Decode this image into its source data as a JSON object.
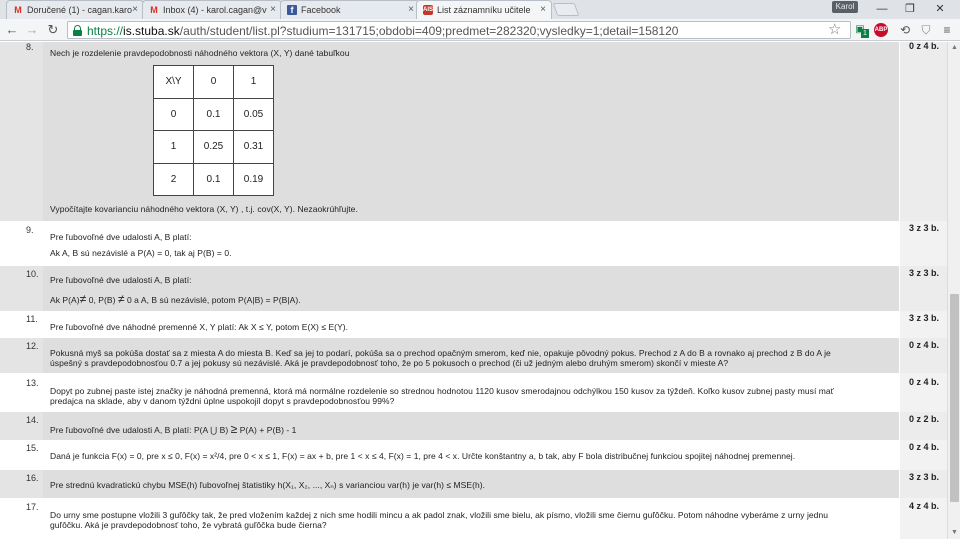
{
  "tabs": [
    {
      "label": "Doručené (1) - cagan.karo",
      "icon": "gmail-icon"
    },
    {
      "label": "Inbox (4) - karol.cagan@v",
      "icon": "gmail-icon"
    },
    {
      "label": "Facebook",
      "icon": "facebook-icon"
    },
    {
      "label": "List záznamníku učitele",
      "icon": "ais-icon"
    }
  ],
  "user_badge": "Karol",
  "window": {
    "minimize": "—",
    "restore": "❐",
    "close": "✕"
  },
  "toolbar": {
    "back": "←",
    "forward": "→",
    "reload": "↻",
    "url_scheme": "https://",
    "url_host": "is.stuba.sk",
    "url_path": "/auth/student/list.pl?studium=131715;obdobi=409;predmet=282320;vysledky=1;detail=158120",
    "zoom_glyph": "⌕",
    "star": "☆",
    "ext_badge_count": "1",
    "abp_label": "ABP"
  },
  "questions": [
    {
      "num": "8.",
      "points": "0 z 4 b.",
      "lines": [
        "Nech je rozdelenie pravdepodobnosti náhodného vektora  (X, Y)  dané tabuľkou",
        "Vypočítajte kovarianciu náhodného vektora  (X, Y) , t.j. cov(X, Y). Nezaokrúhľujte."
      ],
      "table": [
        [
          "X\\Y",
          "0",
          "1"
        ],
        [
          "0",
          "0.1",
          "0.05"
        ],
        [
          "1",
          "0.25",
          "0.31"
        ],
        [
          "2",
          "0.1",
          "0.19"
        ]
      ]
    },
    {
      "num": "9.",
      "points": "3 z 3 b.",
      "lines": [
        "Pre ľubovoľné dve udalosti  A, B  platí:",
        "Ak A, B  sú nezávislé a  P(A) = 0, tak aj  P(B) = 0."
      ]
    },
    {
      "num": "10.",
      "points": "3 z 3 b.",
      "lines": [
        "Pre ľubovoľné dve udalosti  A, B  platí:",
        "Ak  P(A)",
        " 0, P(B) ",
        " 0  a  A, B  sú nezávislé, potom  P(A|B) = P(B|A)."
      ],
      "neq": "≠"
    },
    {
      "num": "11.",
      "points": "3 z 3 b.",
      "lines": [
        "Pre ľubovoľné dve náhodné premenné  X, Y  platí: Ak  X ≤ Y, potom  E(X) ≤ E(Y)."
      ]
    },
    {
      "num": "12.",
      "points": "0 z 4 b.",
      "lines": [
        "Pokusná myš sa pokúša dostať sa z miesta A do miesta B. Keď sa jej to podarí, pokúša sa o prechod opačným smerom, keď nie, opakuje pôvodný pokus. Prechod z A do B a rovnako aj prechod z B do A je",
        "úspešný s pravdepodobnosťou 0.7 a jej pokusy sú nezávislé. Aká je pravdepodobnosť toho, že po 5 pokusoch o prechod (či už jedným alebo druhým smerom) skončí v mieste A?"
      ]
    },
    {
      "num": "13.",
      "points": "0 z 4 b.",
      "lines": [
        "Dopyt po zubnej paste istej značky je náhodná premenná, ktorá má normálne rozdelenie so strednou hodnotou 1120 kusov smerodajnou odchýlkou 150 kusov za týždeň. Koľko kusov zubnej pasty musí mať",
        "predajca na sklade, aby v danom týždni úplne uspokojil dopyt s pravdepodobnosťou 99%?"
      ]
    },
    {
      "num": "14.",
      "points": "0 z 2 b.",
      "lines": [
        "Pre ľubovoľné dve udalosti  A, B  platí:  P(A ⋃ B) ",
        " P(A) + P(B) - 1"
      ],
      "geq": "≥"
    },
    {
      "num": "15.",
      "points": "0 z 4 b.",
      "lines": [
        "Daná je funkcia  F(x) = 0, pre  x ≤ 0, F(x) = x²/4, pre  0 < x ≤ 1, F(x) = ax + b, pre  1 < x ≤ 4, F(x) = 1, pre  4 < x. Určte konštantny  a, b  tak, aby  F  bola distribučnej funkciou spojitej náhodnej premennej."
      ]
    },
    {
      "num": "16.",
      "points": "3 z 3 b.",
      "lines": [
        "Pre strednú kvadratickú chybu  MSE(h)  ľubovoľnej štatistiky  h(X₁, X₂, ..., Xₙ)  s varianciou  var(h)  je  var(h) ≤ MSE(h)."
      ]
    },
    {
      "num": "17.",
      "points": "4 z 4 b.",
      "lines": [
        "Do urny sme postupne vložili 3 guľôčky tak, že pred vložením každej z nich sme hodili mincu a ak padol znak, vložili sme bielu, ak písmo, vložili sme čiernu guľôčku. Potom náhodne vyberáme z urny jednu",
        "guľôčku. Aká je pravdepodobnosť toho, že vybratá guľôčka bude čierna?"
      ]
    }
  ]
}
